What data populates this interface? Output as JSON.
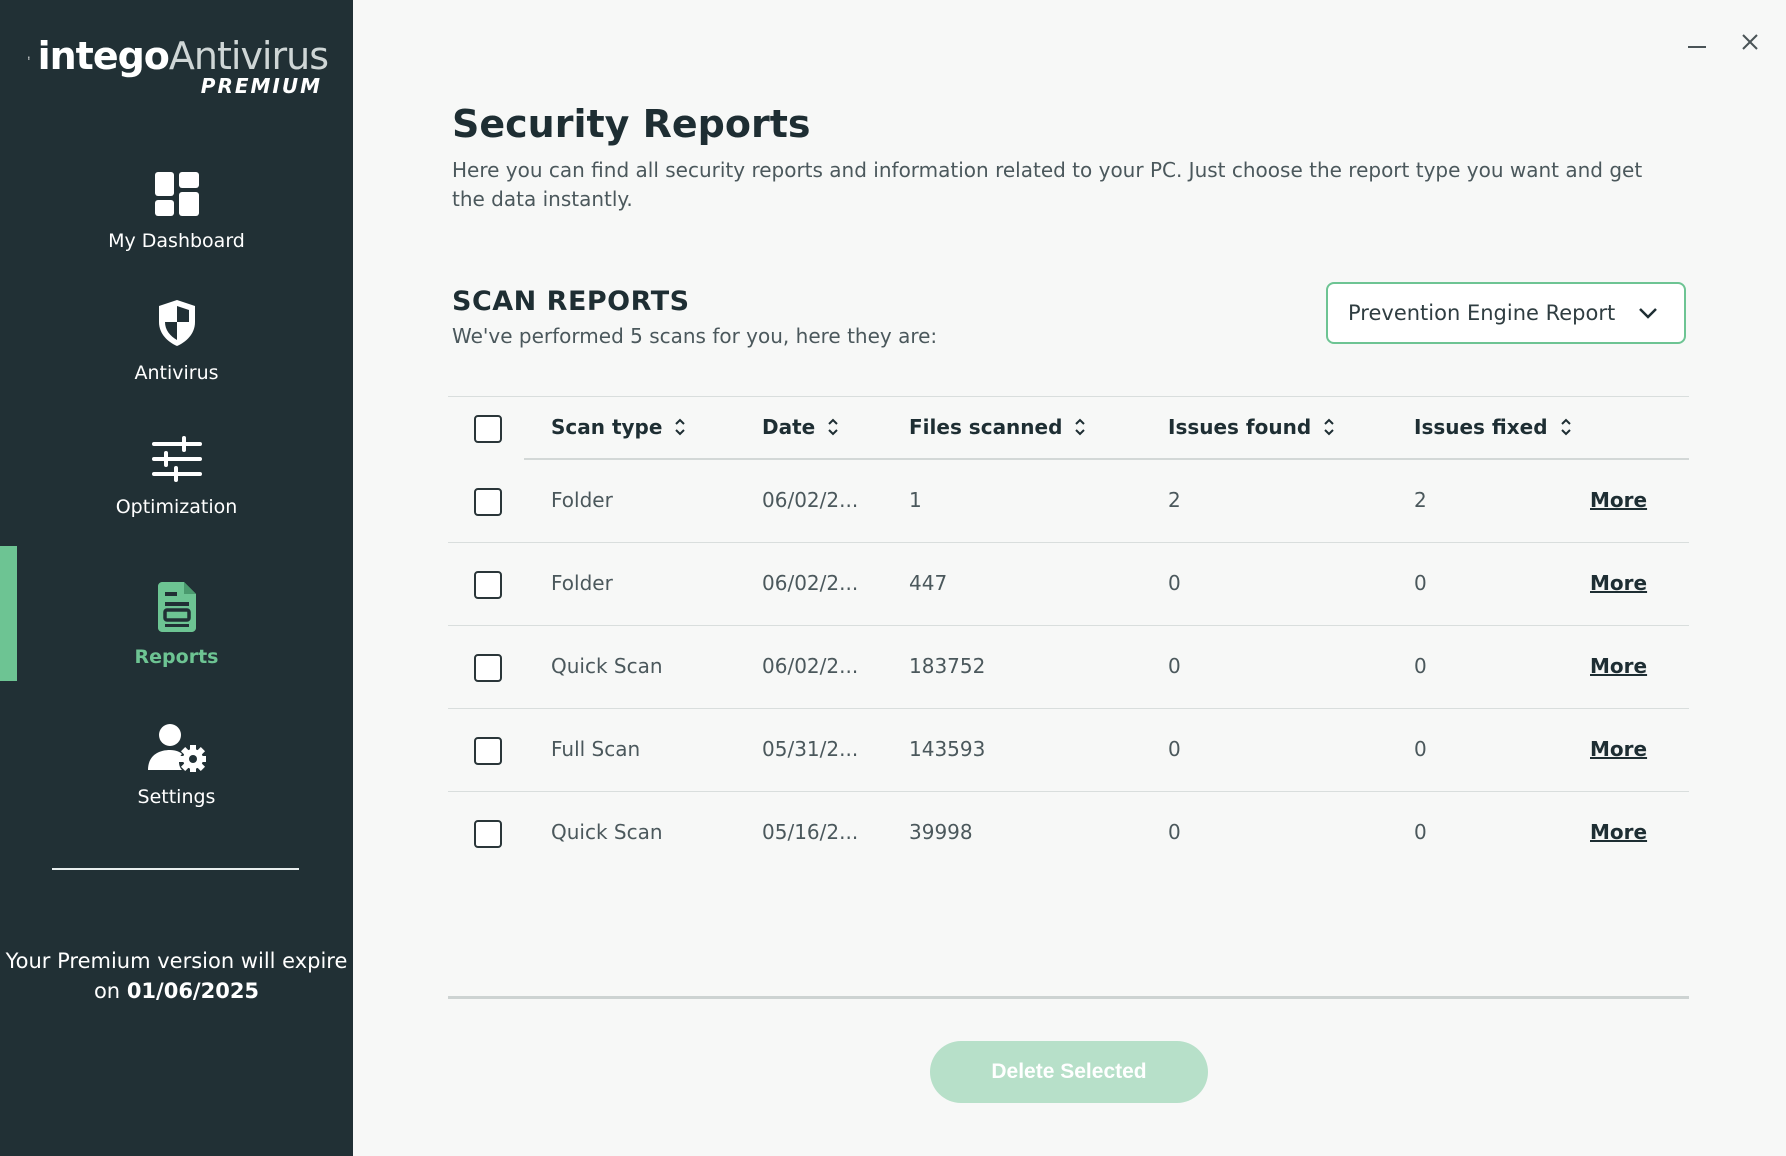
{
  "brand": {
    "name_bold": "intego",
    "name_light": "Antivirus",
    "tier": "PREMIUM"
  },
  "sidebar": {
    "items": [
      {
        "label": "My Dashboard",
        "icon": "dashboard-icon"
      },
      {
        "label": "Antivirus",
        "icon": "shield-icon"
      },
      {
        "label": "Optimization",
        "icon": "sliders-icon"
      },
      {
        "label": "Reports",
        "icon": "report-document-icon",
        "active": true
      },
      {
        "label": "Settings",
        "icon": "user-gear-icon"
      }
    ],
    "expire_text": "Your Premium version will expire on",
    "expire_date": "01/06/2025"
  },
  "colors": {
    "sidebar_bg": "#213035",
    "accent": "#6dc493",
    "button_disabled": "#b7e0c9"
  },
  "page": {
    "title": "Security Reports",
    "description": "Here you can find all security reports and information related to your PC. Just choose the report type you want and get the data instantly."
  },
  "section": {
    "title": "SCAN REPORTS",
    "subtitle": "We've performed 5 scans for you, here they are:"
  },
  "report_type": {
    "selected": "Prevention Engine Report"
  },
  "table": {
    "columns": [
      "Scan type",
      "Date",
      "Files scanned",
      "Issues found",
      "Issues fixed"
    ],
    "more_label": "More",
    "rows": [
      {
        "scan_type": "Folder",
        "date": "06/02/2...",
        "files": "1",
        "found": "2",
        "fixed": "2"
      },
      {
        "scan_type": "Folder",
        "date": "06/02/2...",
        "files": "447",
        "found": "0",
        "fixed": "0"
      },
      {
        "scan_type": "Quick Scan",
        "date": "06/02/2...",
        "files": "183752",
        "found": "0",
        "fixed": "0"
      },
      {
        "scan_type": "Full Scan",
        "date": "05/31/2...",
        "files": "143593",
        "found": "0",
        "fixed": "0"
      },
      {
        "scan_type": "Quick Scan",
        "date": "05/16/2...",
        "files": "39998",
        "found": "0",
        "fixed": "0"
      }
    ]
  },
  "actions": {
    "delete_label": "Delete Selected"
  }
}
